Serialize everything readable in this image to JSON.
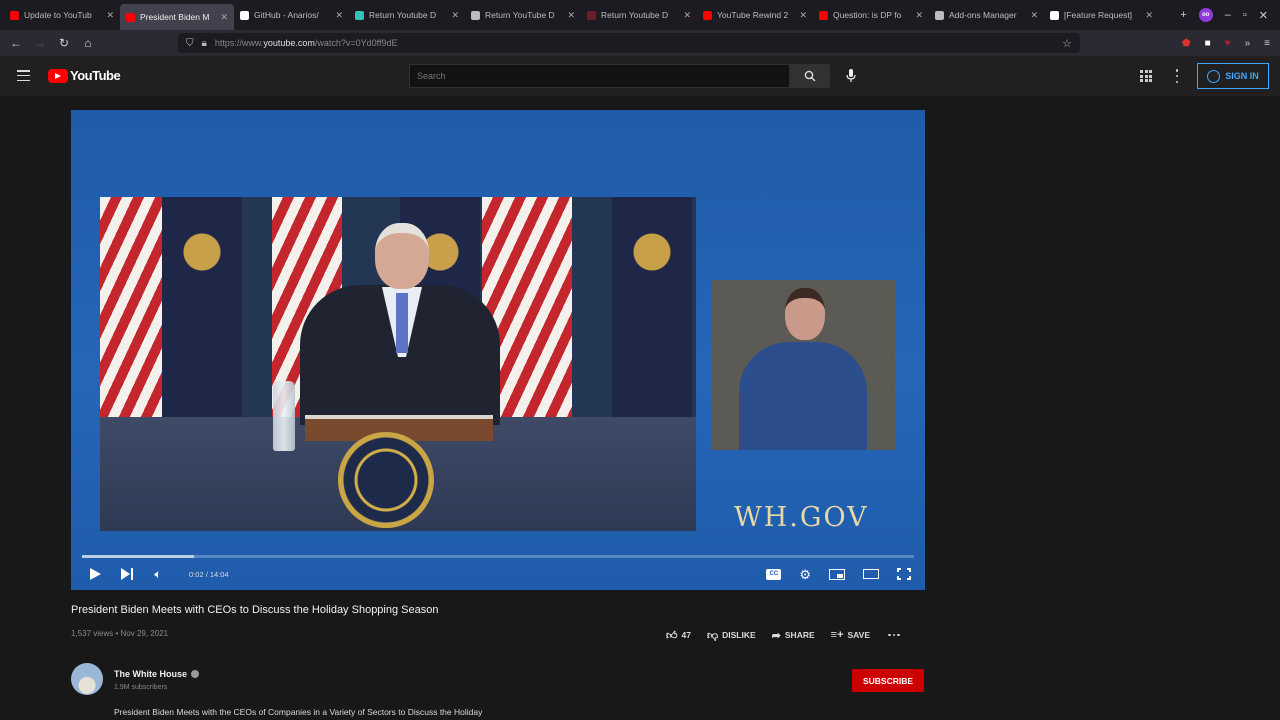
{
  "browser": {
    "tabs": [
      {
        "label": "Update to YouTub",
        "favicon_color": "#ff0000",
        "active": false
      },
      {
        "label": "President Biden M",
        "favicon_color": "#ff0000",
        "active": true
      },
      {
        "label": "GitHub - Anarios/",
        "favicon_color": "#ffffff",
        "active": false
      },
      {
        "label": "Return Youtube D",
        "favicon_color": "#2ec4b6",
        "active": false
      },
      {
        "label": "Return YouTube D",
        "favicon_color": "#bbbbbb",
        "active": false
      },
      {
        "label": "Return Youtube D",
        "favicon_color": "#6b1f2a",
        "active": false
      },
      {
        "label": "YouTube Rewind 2",
        "favicon_color": "#ff0000",
        "active": false
      },
      {
        "label": "Question: is DP fo",
        "favicon_color": "#ff0000",
        "active": false
      },
      {
        "label": "Add-ons Manager",
        "favicon_color": "#bbbbbb",
        "active": false
      },
      {
        "label": "[Feature Request]",
        "favicon_color": "#ffffff",
        "active": false
      }
    ],
    "url": {
      "prefix": "https://www.",
      "host": "youtube.com",
      "path": "/watch?v=0Yd0ff9dE"
    }
  },
  "youtube": {
    "logo_text": "YouTube",
    "search_placeholder": "Search",
    "signin_label": "SIGN IN"
  },
  "player": {
    "overlay_text": "WH.GOV",
    "time_current": "0:02",
    "time_total": "14:04",
    "buffer_fraction": 0.135
  },
  "video": {
    "title": "President Biden Meets with CEOs to Discuss the Holiday Shopping Season",
    "views": "1,537 views",
    "date": "Nov 29, 2021",
    "likes": "47",
    "dislike_label": "DISLIKE",
    "share_label": "SHARE",
    "save_label": "SAVE"
  },
  "channel": {
    "name": "The White House",
    "subscribers": "1.9M subscribers",
    "subscribe_label": "SUBSCRIBE",
    "description": "President Biden Meets with the CEOs of Companies in a Variety of Sectors to Discuss the Holiday"
  },
  "colors": {
    "accent_blue": "#3ea6ff",
    "subscribe_red": "#cc0000",
    "player_blue": "#2566b8"
  }
}
